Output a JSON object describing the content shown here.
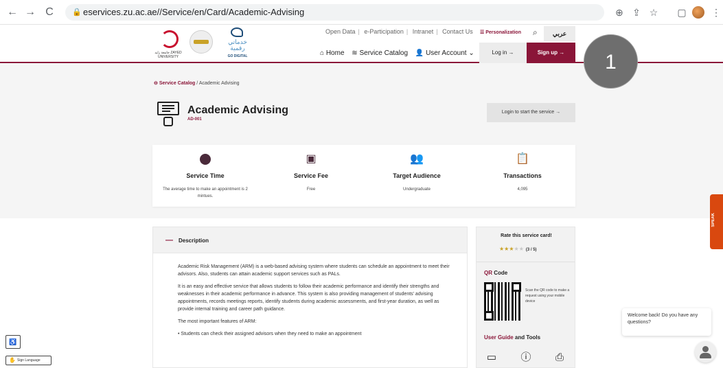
{
  "browser": {
    "url": "eservices.zu.ac.ae//Service/en/Card/Academic-Advising",
    "back_icon": "←",
    "forward_icon": "→",
    "reload_icon": "C"
  },
  "header": {
    "zu_logo_text": "جامعة زايد ZAYED UNIVERSITY",
    "go_digital_ar": "خدماتي رقمية",
    "go_digital_en": "GO DIGITAL",
    "top_links": [
      "Open Data",
      "e-Participation",
      "Intranet",
      "Contact Us"
    ],
    "personalization": "Personalization",
    "language": "عربي",
    "nav": {
      "home": "Home",
      "catalog": "Service Catalog",
      "account": "User Account"
    },
    "login": "Log in →",
    "signup": "Sign up →"
  },
  "step_badge": "1",
  "breadcrumb": {
    "home": "Service Catalog",
    "separator": "/",
    "current": "Academic Advising"
  },
  "service": {
    "title": "Academic Advising",
    "code": "AD-001",
    "start_button": "Login to start the service →"
  },
  "stats": [
    {
      "label": "Service Time",
      "value": "The average time to make an appointment is 2 mintues."
    },
    {
      "label": "Service Fee",
      "value": "Free"
    },
    {
      "label": "Target Audience",
      "value": "Undergraduate"
    },
    {
      "label": "Transactions",
      "value": "4,095"
    }
  ],
  "description": {
    "toggle": "—",
    "title": "Description",
    "paragraphs": [
      "Academic Risk Management (ARM) is a web-based advising system where students can schedule an appointment to meet their advisors. Also, students can attain academic support services such as PALs.",
      "It is an easy and effective service that allows students to follow their academic performance and identify their strengths and weaknesses in their academic performance in advance. This system is also providing management of students' advising appointments, records meetings reports, identify students during academic assessments, and first-year duration, as well as provide internal training and career path guidance.",
      "The most important features of ARM:",
      "• Students can check their assigned advisors when they need to make an appointment"
    ]
  },
  "sidebar": {
    "rate_title": "Rate this service card!",
    "rating_score": "(3 / 5)",
    "rating_value": 3,
    "qr_heading_accent": "QR",
    "qr_heading_rest": " Code",
    "qr_caption": "Scan the QR code to make a request using your mobile device",
    "guide_heading_accent": "User Guide",
    "guide_heading_rest": " and Tools"
  },
  "widgets": {
    "speak": "SPEAK",
    "chat_message": "Welcome back! Do you have any questions?",
    "sign_language": "Sign Language"
  },
  "colors": {
    "brand": "#8a1538",
    "star": "#c9a227",
    "speak": "#d9480f"
  }
}
